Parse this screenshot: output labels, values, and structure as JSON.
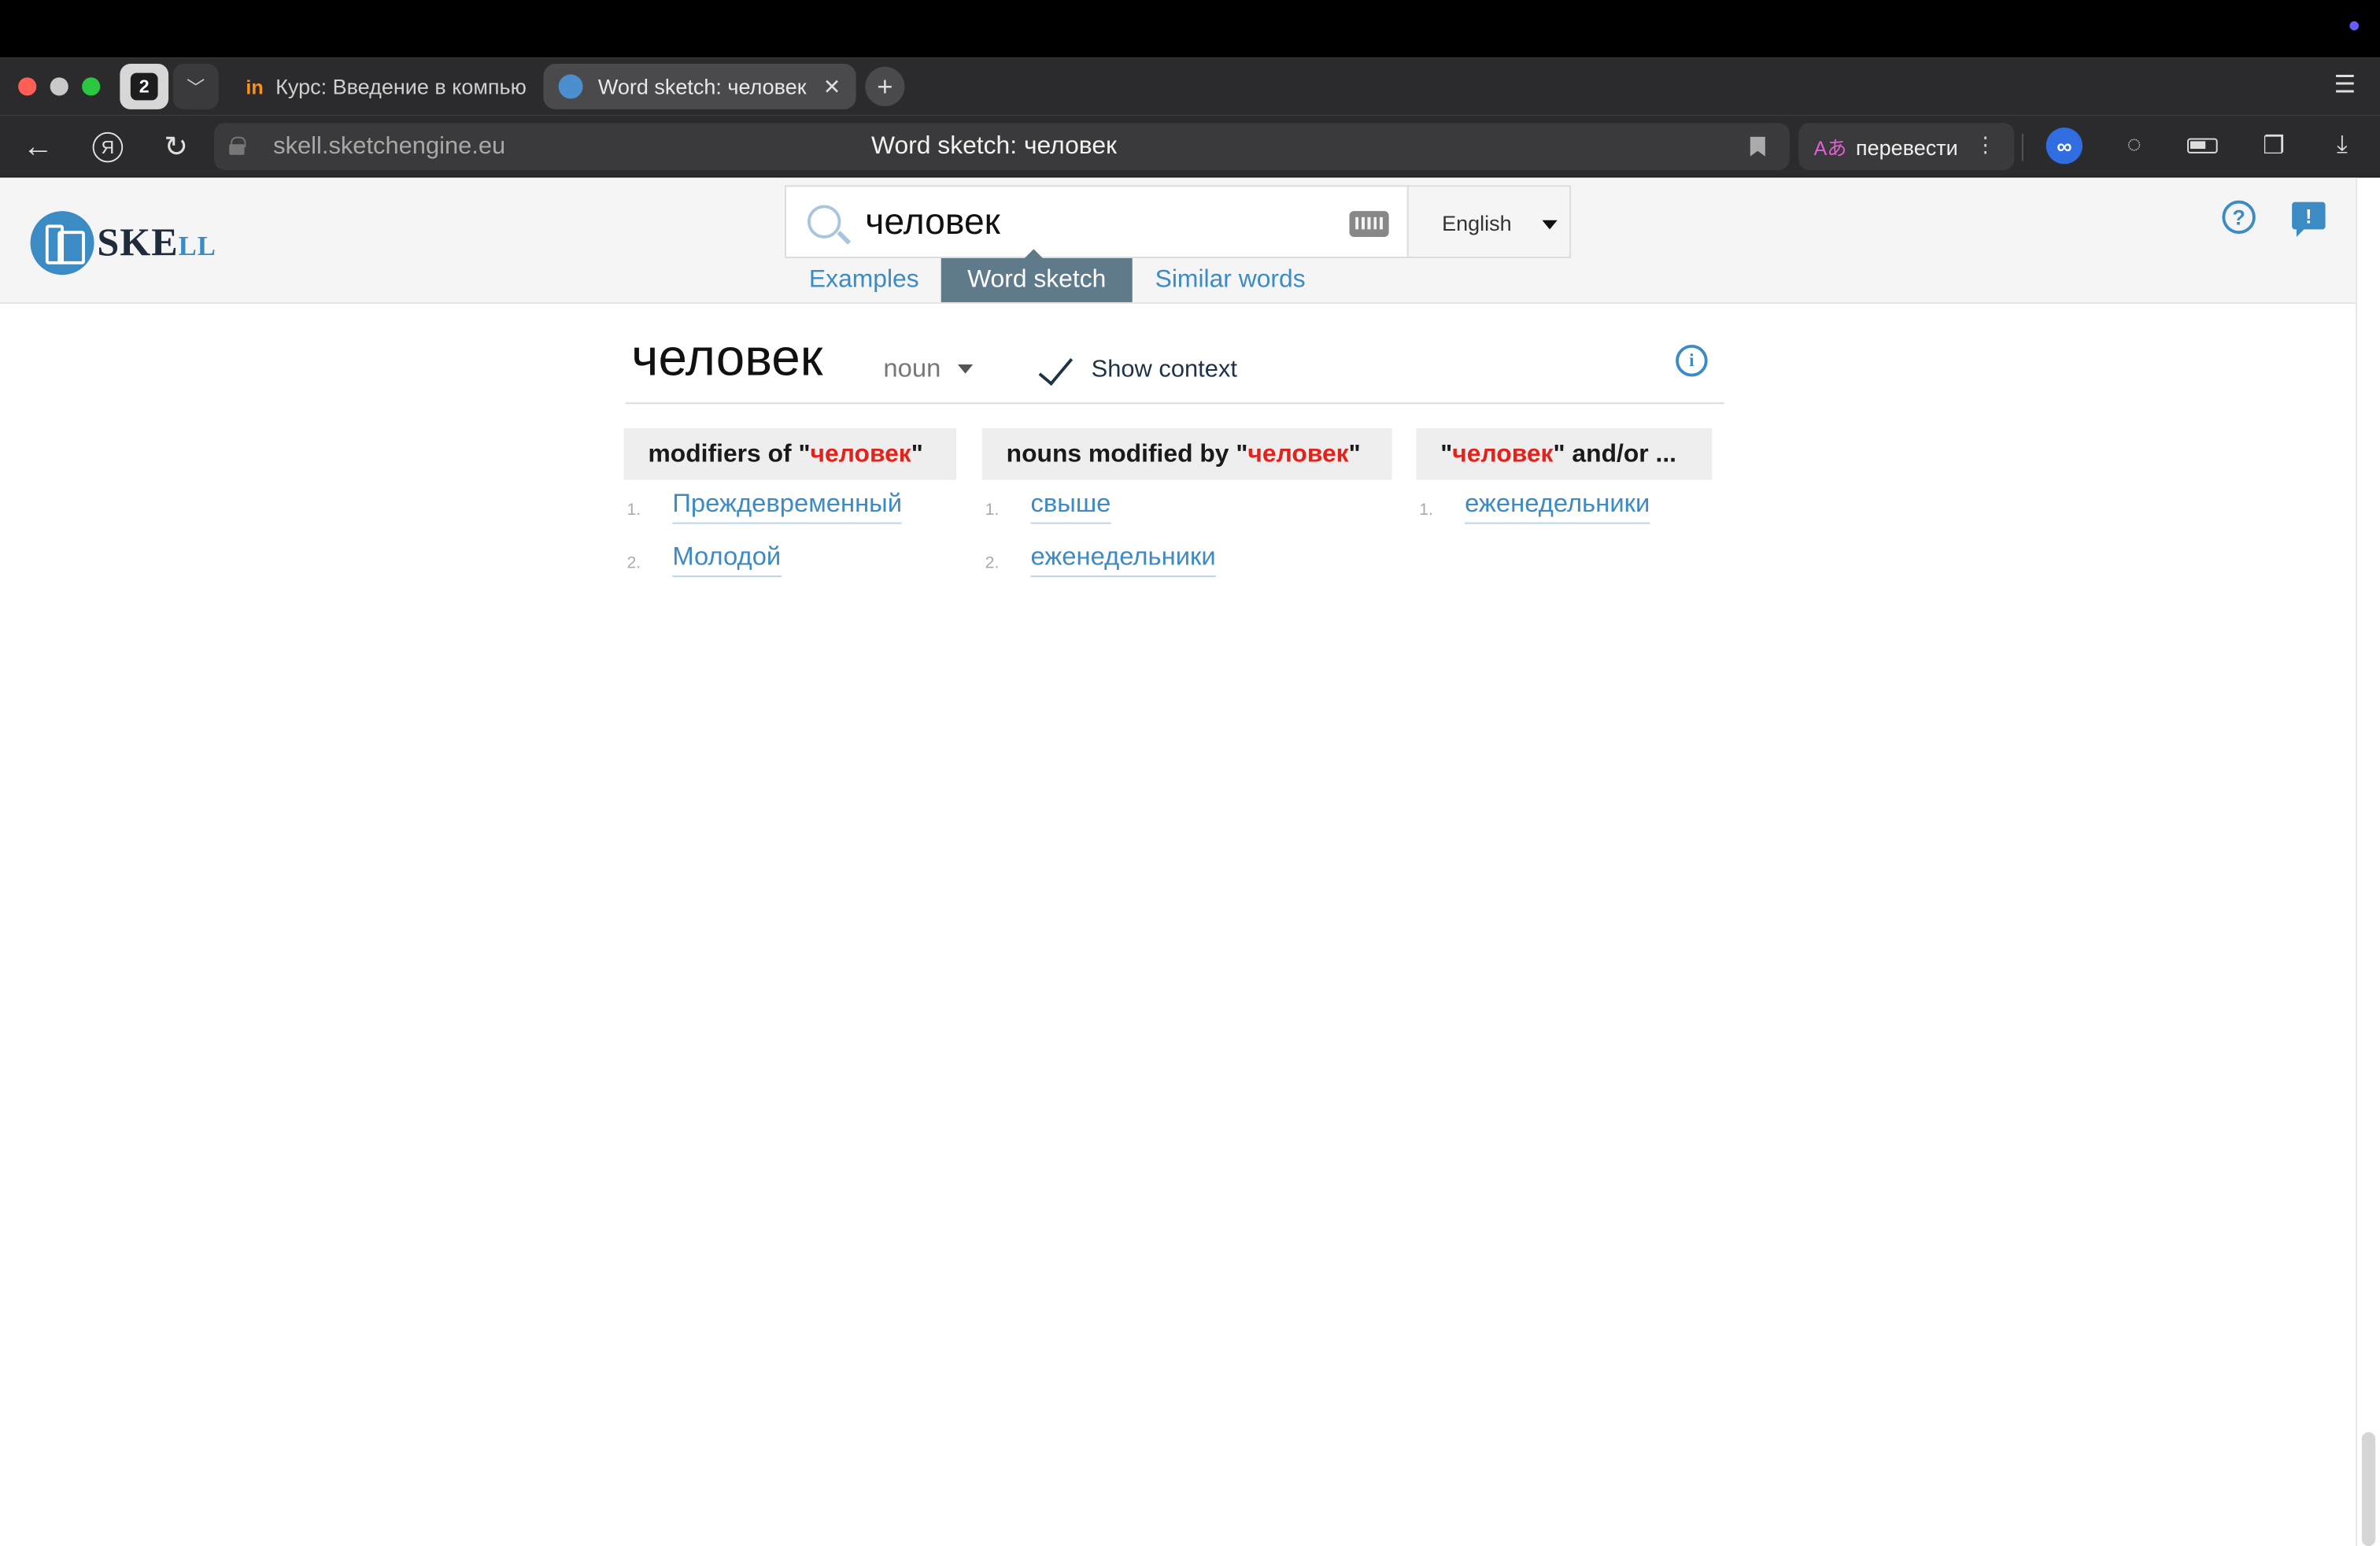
{
  "browser": {
    "tab_count": "2",
    "tabs": [
      {
        "label": "Курс: Введение в компью",
        "favicon": "in"
      },
      {
        "label": "Word sketch: человек",
        "favicon": "globe-icon"
      }
    ],
    "url": "skell.sketchengine.eu",
    "page_title": "Word sketch: человек",
    "translate_label": "перевести",
    "translate_icon": "Aあ"
  },
  "header": {
    "logo_text": "SKE",
    "logo_suffix": "LL",
    "search_value": "человек",
    "language": "English",
    "nav_tabs": [
      "Examples",
      "Word sketch",
      "Similar words"
    ],
    "active_tab": "Word sketch"
  },
  "main": {
    "lemma": "человек",
    "pos": "noun",
    "show_context": "Show context"
  },
  "columns": [
    {
      "prefix": "modifiers of \"",
      "highlight": "человек",
      "suffix": "\"",
      "items": [
        {
          "num": "1.",
          "word": "Преждевременный"
        },
        {
          "num": "2.",
          "word": "Молодой"
        }
      ]
    },
    {
      "prefix": "nouns modified by \"",
      "highlight": "человек",
      "suffix": "\"",
      "items": [
        {
          "num": "1.",
          "word": "свыше"
        },
        {
          "num": "2.",
          "word": "еженедельники"
        }
      ]
    },
    {
      "prefix": "\"",
      "highlight": "человек",
      "suffix": "\" and/or ...",
      "items": [
        {
          "num": "1.",
          "word": "еженедельники"
        }
      ]
    }
  ],
  "colors": {
    "accent": "#3c8bc4",
    "active_tab": "#5f7a8a",
    "highlight": "#e3231b"
  }
}
